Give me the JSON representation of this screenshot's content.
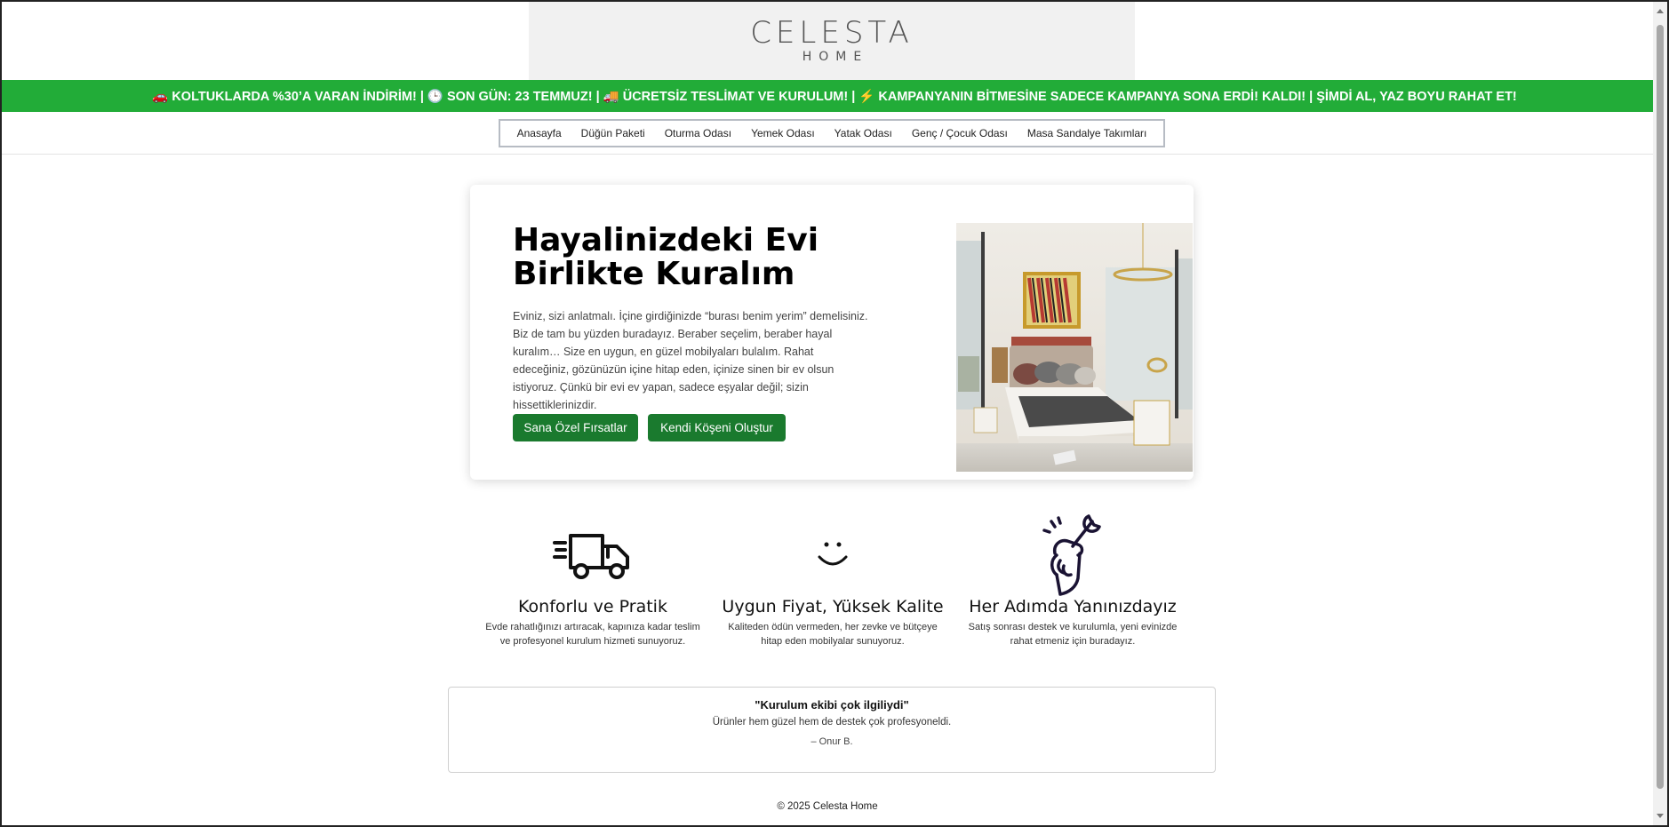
{
  "logo": {
    "main": "CELESTA",
    "sub": "HOME"
  },
  "promo": {
    "text": "🚗 KOLTUKLARDA %30’A VARAN İNDİRİM! | 🕒 SON GÜN: 23 TEMMUZ! | 🚚 ÜCRETSİZ TESLİMAT VE KURULUM! | ⚡ KAMPANYANIN BİTMESİNE SADECE KAMPANYA SONA ERDİ! KALDI! | ŞİMDİ AL, YAZ BOYU RAHAT ET!"
  },
  "nav": {
    "items": [
      {
        "label": "Anasayfa"
      },
      {
        "label": "Düğün Paketi"
      },
      {
        "label": "Oturma Odası"
      },
      {
        "label": "Yemek Odası"
      },
      {
        "label": "Yatak Odası"
      },
      {
        "label": "Genç / Çocuk Odası"
      },
      {
        "label": "Masa Sandalye Takımları"
      }
    ]
  },
  "hero": {
    "title": "Hayalinizdeki Evi Birlikte Kuralım",
    "text": "Eviniz, sizi anlatmalı. İçine girdiğinizde “burası benim yerim” demelisiniz. Biz de tam bu yüzden buradayız. Beraber seçelim, beraber hayal kuralım… Size en uygun, en güzel mobilyaları bulalım. Rahat edeceğiniz, gözünüzün içine hitap eden, içinize sinen bir ev olsun istiyoruz. Çünkü bir evi ev yapan, sadece eşyalar değil; sizin hissettiklerinizdir.",
    "button1": "Sana Özel Fırsatlar",
    "button2": "Kendi Köşeni Oluştur"
  },
  "features": [
    {
      "icon": "delivery-truck-icon",
      "title": "Konforlu ve Pratik",
      "text": "Evde rahatlığınızı artıracak, kapınıza kadar teslim ve profesyonel kurulum hizmeti sunuyoruz."
    },
    {
      "icon": "smile-icon",
      "title": "Uygun Fiyat, Yüksek Kalite",
      "text": "Kaliteden ödün vermeden, her zevke ve bütçeye hitap eden mobilyalar sunuyoruz."
    },
    {
      "icon": "hand-wrench-icon",
      "title": "Her Adımda Yanınızdayız",
      "text": "Satış sonrası destek ve kurulumla, yeni evinizde rahat etmeniz için buradayız."
    }
  ],
  "testimonial": {
    "title": "\"Kurulum ekibi çok ilgiliydi\"",
    "text": "Ürünler hem güzel hem de destek çok profesyoneldi.",
    "author": "– Onur B."
  },
  "footer": {
    "text": "© 2025 Celesta Home"
  }
}
